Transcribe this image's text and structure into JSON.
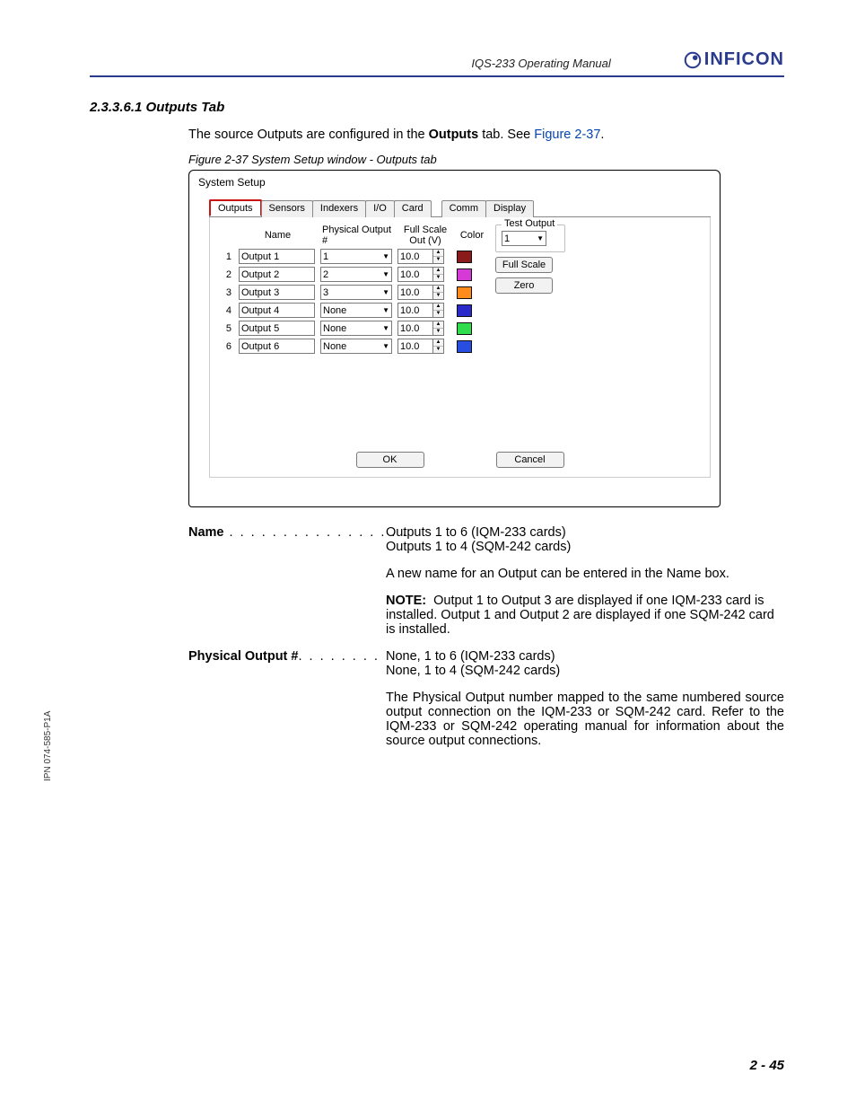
{
  "header": {
    "doc_title": "IQS-233 Operating Manual",
    "brand": "INFICON"
  },
  "section": {
    "number_title": "2.3.3.6.1  Outputs Tab",
    "intro_pre": "The source Outputs are configured in the ",
    "intro_bold": "Outputs",
    "intro_post": " tab. See ",
    "intro_figref": "Figure 2-37",
    "intro_end": ".",
    "caption": "Figure 2-37  System Setup window - Outputs tab"
  },
  "window": {
    "title": "System Setup",
    "tabs": [
      "Outputs",
      "Sensors",
      "Indexers",
      "I/O",
      "Card",
      "Comm",
      "Display"
    ],
    "columns": {
      "name": "Name",
      "phys": "Physical Output #",
      "fs_line1": "Full Scale",
      "fs_line2": "Out (V)",
      "color": "Color"
    },
    "rows": [
      {
        "idx": "1",
        "name": "Output 1",
        "phys": "1",
        "fs": "10.0",
        "color": "#8b1a1a"
      },
      {
        "idx": "2",
        "name": "Output 2",
        "phys": "2",
        "fs": "10.0",
        "color": "#d63ad6"
      },
      {
        "idx": "3",
        "name": "Output 3",
        "phys": "3",
        "fs": "10.0",
        "color": "#ff8c1a"
      },
      {
        "idx": "4",
        "name": "Output 4",
        "phys": "None",
        "fs": "10.0",
        "color": "#2a2acb"
      },
      {
        "idx": "5",
        "name": "Output 5",
        "phys": "None",
        "fs": "10.0",
        "color": "#2fdc4b"
      },
      {
        "idx": "6",
        "name": "Output 6",
        "phys": "None",
        "fs": "10.0",
        "color": "#274ee0"
      }
    ],
    "test_output": {
      "legend": "Test Output",
      "value": "1",
      "full_scale": "Full Scale",
      "zero": "Zero"
    },
    "ok": "OK",
    "cancel": "Cancel"
  },
  "definitions": {
    "name": {
      "term": "Name",
      "dots": " . . . . . . . . . . . . . . . . . ",
      "line1": "Outputs 1 to 6 (IQM-233 cards)",
      "line2": "Outputs 1 to 4 (SQM-242 cards)",
      "para2": "A new name for an Output can be entered in the Name box.",
      "note_label": "NOTE:",
      "note": "Output 1 to Output 3 are displayed if one IQM-233 card is installed. Output 1 and Output 2 are displayed if one SQM-242 card is installed."
    },
    "phys": {
      "term": "Physical Output #",
      "dots": ". . . . . . . . ",
      "line1": "None, 1 to 6 (IQM-233 cards)",
      "line2": "None, 1 to 4 (SQM-242 cards)",
      "para2": "The Physical Output number mapped to the same numbered source output connection on the IQM-233 or SQM-242 card. Refer to the IQM-233 or SQM-242 operating manual for information about the source output connections."
    }
  },
  "side_text": "IPN 074-585-P1A",
  "footer": "2 - 45"
}
